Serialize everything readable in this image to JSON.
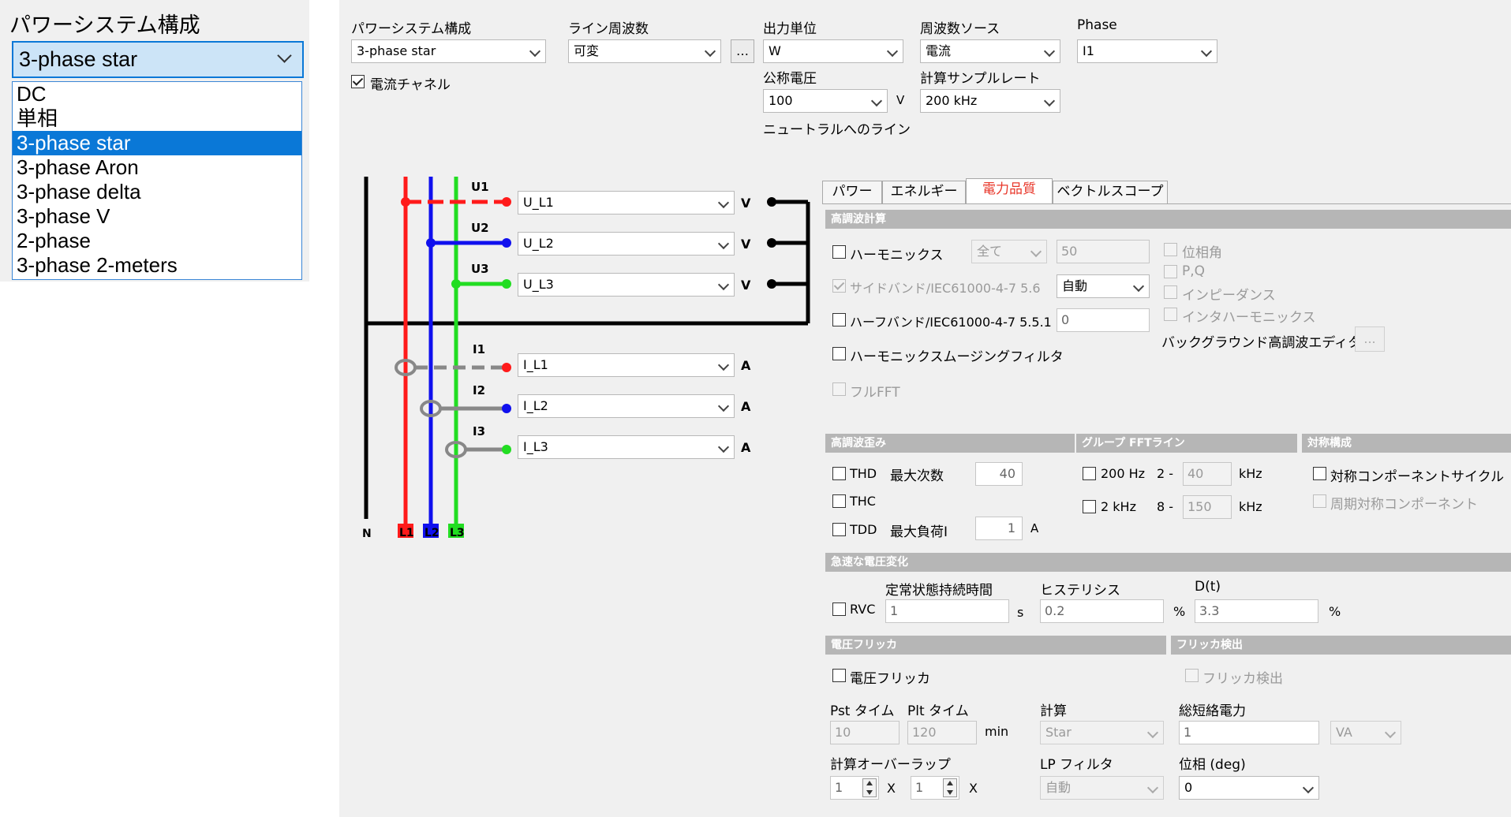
{
  "left_dropdown": {
    "label": "パワーシステム構成",
    "selected": "3-phase star",
    "options": [
      "DC",
      "単相",
      "3-phase star",
      "3-phase Aron",
      "3-phase delta",
      "3-phase V",
      "2-phase",
      "3-phase 2-meters"
    ],
    "highlighted_index": 2
  },
  "top": {
    "power_system_label": "パワーシステム構成",
    "power_system_value": "3-phase star",
    "line_freq_label": "ライン周波数",
    "line_freq_value": "可変",
    "ellipsis": "…",
    "output_unit_label": "出力単位",
    "output_unit_value": "W",
    "freq_source_label": "周波数ソース",
    "freq_source_value": "電流",
    "phase_label": "Phase",
    "phase_value": "I1",
    "current_channel_label": "電流チャネル",
    "current_channel_checked": true,
    "nominal_voltage_label": "公称電圧",
    "nominal_voltage_value": "100",
    "nominal_voltage_unit": "V",
    "neutral_line_label": "ニュートラルへのライン",
    "sample_rate_label": "計算サンプルレート",
    "sample_rate_value": "200 kHz"
  },
  "wiring": {
    "voltage_rows": [
      {
        "label": "U1",
        "channel": "U_L1",
        "unit": "V",
        "color": "#ff1a1a"
      },
      {
        "label": "U2",
        "channel": "U_L2",
        "unit": "V",
        "color": "#1010ee"
      },
      {
        "label": "U3",
        "channel": "U_L3",
        "unit": "V",
        "color": "#22dd22"
      }
    ],
    "current_rows": [
      {
        "label": "I1",
        "channel": "I_L1",
        "unit": "A"
      },
      {
        "label": "I2",
        "channel": "I_L2",
        "unit": "A"
      },
      {
        "label": "I3",
        "channel": "I_L3",
        "unit": "A"
      }
    ],
    "terminals": [
      "N",
      "L1",
      "L2",
      "L3"
    ]
  },
  "tabs": [
    "パワー",
    "エネルギー",
    "電力品質",
    "ベクトルスコープ"
  ],
  "active_tab": "電力品質",
  "harmonics": {
    "section": "高調波計算",
    "harmonics_label": "ハーモニックス",
    "harmonics_select": "全て",
    "harmonics_count": "50",
    "sideband_label": "サイドバンド/IEC61000-4-7 5.6",
    "sideband_value": "自動",
    "halfband_label": "ハーフバンド/IEC61000-4-7 5.5.1",
    "halfband_value": "0",
    "smoothing_label": "ハーモニックスムージングフィルタ",
    "full_fft_label": "フルFFT",
    "phase_angle_label": "位相角",
    "pq_label": "P,Q",
    "impedance_label": "インピーダンス",
    "interharmonics_label": "インタハーモニックス",
    "bg_editor_label": "バックグラウンド高調波エディタ",
    "bg_editor_btn": "..."
  },
  "distortion": {
    "section": "高調波歪み",
    "thd_label": "THD",
    "max_order_label": "最大次数",
    "max_order_value": "40",
    "thc_label": "THC",
    "tdd_label": "TDD",
    "max_load_label": "最大負荷I",
    "max_load_value": "1",
    "max_load_unit": "A"
  },
  "group_fft": {
    "section": "グループ FFTライン",
    "row1_label": "200 Hz",
    "row1_prefix": "2 -",
    "row1_value": "40",
    "row1_unit": "kHz",
    "row2_label": "2 kHz",
    "row2_prefix": "8 -",
    "row2_value": "150",
    "row2_unit": "kHz"
  },
  "symmetry": {
    "section": "対称構成",
    "cycle_label": "対称コンポーネントサイクル",
    "periodic_label": "周期対称コンポーネント"
  },
  "rvc": {
    "section": "急速な電圧変化",
    "steady_label": "定常状態持続時間",
    "hysteresis_label": "ヒステリシス",
    "dt_label": "D(t)",
    "rvc_label": "RVC",
    "steady_value": "1",
    "steady_unit": "s",
    "hysteresis_value": "0.2",
    "hysteresis_unit": "%",
    "dt_value": "3.3",
    "dt_unit": "%"
  },
  "flicker": {
    "section": "電圧フリッカ",
    "detect_section": "フリッカ検出",
    "voltage_flicker_label": "電圧フリッカ",
    "flicker_detect_label": "フリッカ検出",
    "pst_label": "Pst タイム",
    "pst_value": "10",
    "plt_label": "Plt タイム",
    "plt_value": "120",
    "time_unit": "min",
    "calc_label": "計算",
    "calc_value": "Star",
    "short_circuit_label": "総短絡電力",
    "short_circuit_value": "1",
    "short_circuit_unit": "VA",
    "overlap_label": "計算オーバーラップ",
    "overlap1_value": "1",
    "overlap2_value": "1",
    "x_label": "X",
    "lp_filter_label": "LP フィルタ",
    "lp_filter_value": "自動",
    "phase_label": "位相 (deg)",
    "phase_value": "0"
  }
}
